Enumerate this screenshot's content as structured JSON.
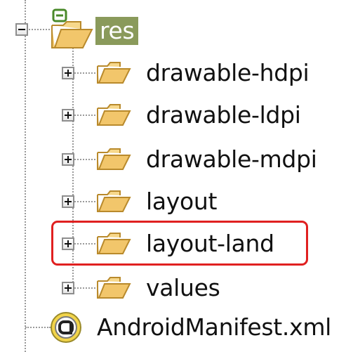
{
  "tree": {
    "root": {
      "label": "res",
      "expanded": true,
      "selected": true
    },
    "children": [
      {
        "label": "drawable-hdpi",
        "expanded": false
      },
      {
        "label": "drawable-ldpi",
        "expanded": false
      },
      {
        "label": "drawable-mdpi",
        "expanded": false
      },
      {
        "label": "layout",
        "expanded": false
      },
      {
        "label": "layout-land",
        "expanded": false,
        "highlighted": true
      },
      {
        "label": "values",
        "expanded": false
      }
    ],
    "sibling": {
      "label": "AndroidManifest.xml",
      "icon": "android-manifest-icon"
    }
  },
  "colors": {
    "selection": "#8a9a5b",
    "highlight": "#e02020",
    "folder": "#f2c66b"
  }
}
